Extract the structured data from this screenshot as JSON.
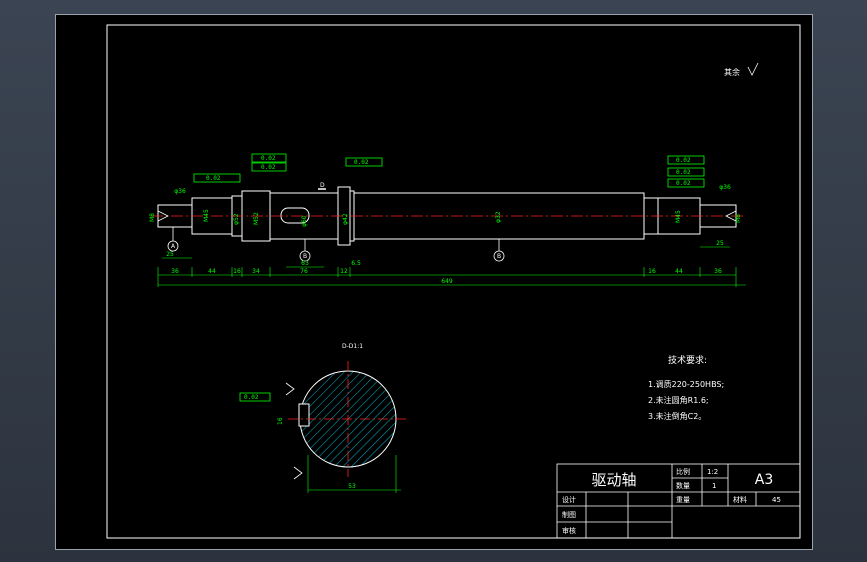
{
  "drawing": {
    "corner_note": "其余",
    "tolerance_frames": [
      "0.02",
      "0.02",
      "0.02",
      "0.02",
      "0.02",
      "0.02",
      "0.02",
      "0.02",
      "0.02"
    ],
    "datum_letters": [
      "A",
      "B",
      "A",
      "B",
      "D",
      "B",
      "C"
    ],
    "diameters_left": [
      "M8",
      "M45",
      "φ52",
      "M52",
      "φ60",
      "φ42"
    ],
    "diameters_right": [
      "φ32",
      "M45",
      "M8"
    ],
    "dims_bottom": [
      "36",
      "44",
      "16",
      "34",
      "76",
      "12",
      "16",
      "44",
      "36"
    ],
    "dim_total": "649",
    "dim_extra": [
      "25",
      "63",
      "6.5",
      "25",
      "φ36",
      "φ36",
      "32",
      "12"
    ],
    "section_title": "D-D1:1",
    "section_width": "53",
    "section_depth": "16",
    "tech_title": "技术要求:",
    "tech_items": [
      "1.调质220-250HBS;",
      "2.未注圆角R1.6;",
      "3.未注倒角C2。"
    ]
  },
  "title_block": {
    "part_name": "驱动轴",
    "scale_label": "比例",
    "scale_value": "1:2",
    "qty_label": "数量",
    "qty_value": "1",
    "size": "A3",
    "weight_label": "重量",
    "material_label": "材料",
    "material_value": "45",
    "design_label": "设计",
    "drawing_label": "制图",
    "review_label": "审核"
  },
  "colors": {
    "background": "#000000",
    "frame": "#ffffff",
    "dimension": "#00ff00",
    "centerline": "#ff2020",
    "hatch": "#00e5ff",
    "shaft": "#ffffff"
  }
}
